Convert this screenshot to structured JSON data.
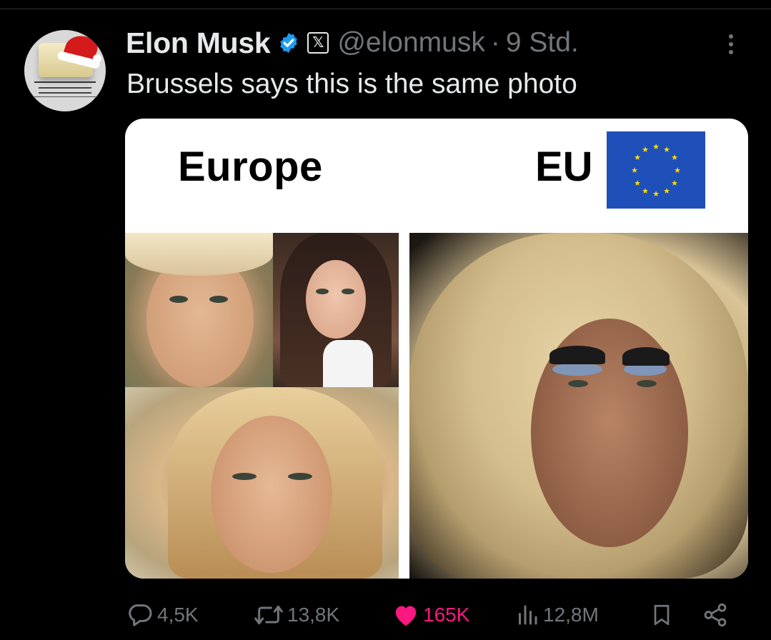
{
  "post": {
    "author": {
      "name": "Elon Musk",
      "handle": "@elonmusk",
      "verified_icon": "verified-badge-icon",
      "affiliation_icon": "x-logo-icon",
      "separator": "·",
      "time": "9 Std."
    },
    "text": "Brussels says this is the same photo",
    "media": {
      "left_label": "Europe",
      "right_label": "EU",
      "flag_icon": "eu-flag-icon"
    },
    "actions": {
      "replies": "4,5K",
      "reposts": "13,8K",
      "likes": "165K",
      "views": "12,8M"
    }
  },
  "colors": {
    "background": "#000000",
    "text_primary": "#e7e9ea",
    "text_secondary": "#71767b",
    "verified_blue": "#1d9bf0",
    "like_pink": "#f91880",
    "eu_blue": "#1f4fb8",
    "eu_star": "#ffdd00"
  }
}
